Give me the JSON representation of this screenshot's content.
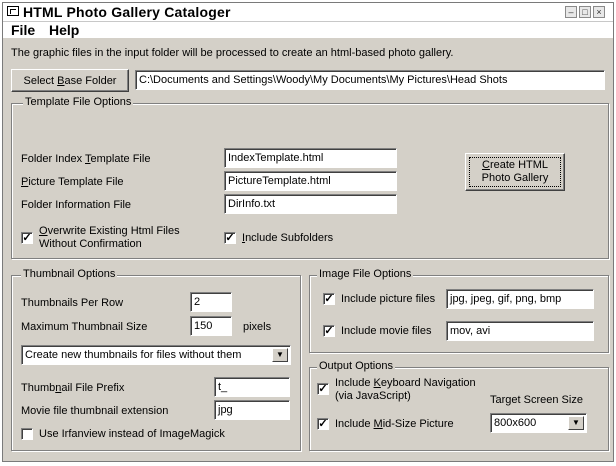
{
  "window": {
    "title": "HTML Photo Gallery Cataloger",
    "controls": [
      "–",
      "□",
      "×"
    ]
  },
  "menu": {
    "file": "File",
    "help": "Help"
  },
  "description": "The graphic files in the input folder will be processed to create an html-based photo gallery.",
  "base_folder": {
    "button_pre": "Select ",
    "button_accel": "B",
    "button_post": "ase Folder",
    "path": "C:\\Documents and Settings\\Woody\\My Documents\\My Pictures\\Head Shots"
  },
  "template": {
    "title": "Template File Options",
    "index_pre": "Folder Index ",
    "index_accel": "T",
    "index_post": "emplate File",
    "index_value": "IndexTemplate.html",
    "picture_accel": "P",
    "picture_post": "icture Template File",
    "picture_value": "PictureTemplate.html",
    "info_label": "Folder Information File",
    "info_value": "DirInfo.txt",
    "overwrite_accel": "O",
    "overwrite_line1": "verwrite Existing Html Files",
    "overwrite_line2": "Without Confirmation",
    "subfolders_accel": "I",
    "subfolders_post": "nclude Subfolders"
  },
  "create_button": {
    "line1_accel": "C",
    "line1_post": "reate HTML",
    "line2": "Photo Gallery"
  },
  "thumbnail": {
    "title": "Thumbnail Options",
    "per_row_label": "Thumbnails Per Row",
    "per_row_value": "2",
    "max_size_label": "Maximum Thumbnail Size",
    "max_size_value": "150",
    "max_size_unit": "pixels",
    "mode_value": "Create new thumbnails for files without them",
    "prefix_pre": "Thumb",
    "prefix_accel": "n",
    "prefix_post": "ail File Prefix",
    "prefix_value": "t_",
    "movie_ext_label": "Movie file thumbnail extension",
    "movie_ext_value": "jpg",
    "irfanview_label": "Use Irfanview instead of ImageMagick"
  },
  "image_files": {
    "title": "Image File Options",
    "pictures_label": "Include picture files",
    "pictures_value": "jpg, jpeg, gif, png, bmp",
    "movies_label": "Include movie files",
    "movies_value": "mov, avi"
  },
  "output": {
    "title": "Output Options",
    "keyboard_pre": "Include ",
    "keyboard_accel": "K",
    "keyboard_post": "eyboard Navigation",
    "keyboard_line2": "(via JavaScript)",
    "midsize_pre": "Include ",
    "midsize_accel": "M",
    "midsize_post": "id-Size Picture",
    "screen_size_label": "Target Screen Size",
    "screen_size_value": "800x600"
  },
  "checkmark": "✓",
  "dropdown_arrow": "▼"
}
